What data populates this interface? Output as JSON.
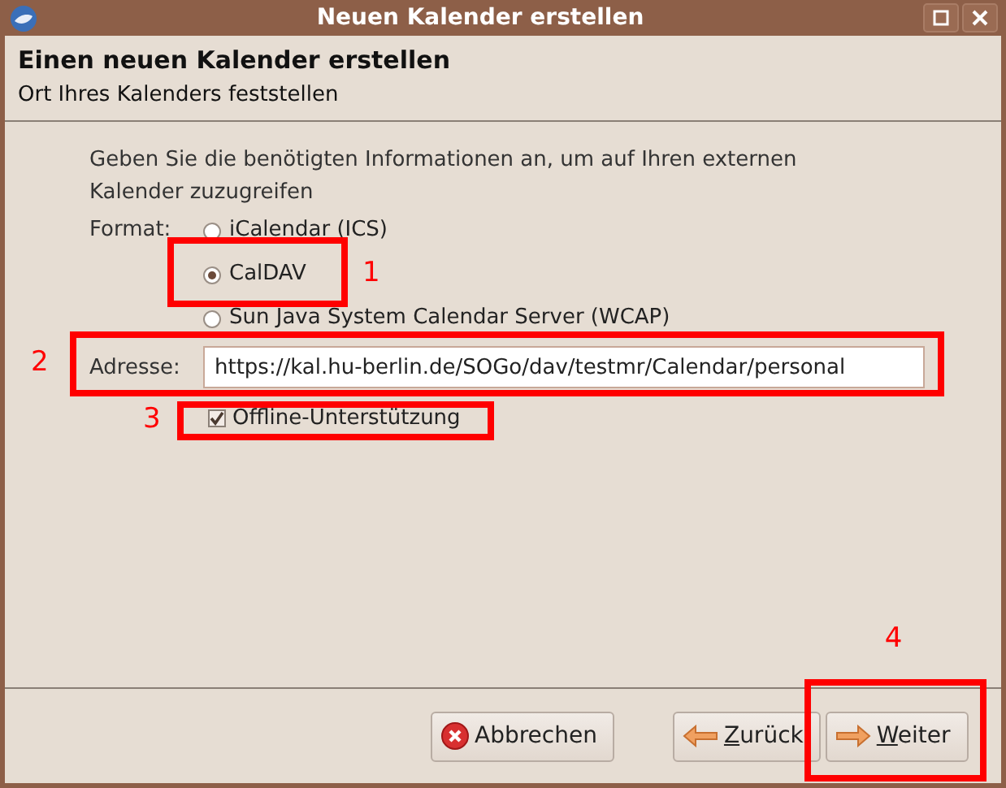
{
  "window": {
    "title": "Neuen Kalender erstellen"
  },
  "header": {
    "title": "Einen neuen Kalender erstellen",
    "subtitle": "Ort Ihres Kalenders feststellen"
  },
  "intro": "Geben Sie die benötigten Informationen an, um auf Ihren externen Kalender zuzugreifen",
  "format": {
    "label": "Format:",
    "options": [
      {
        "label": "iCalendar (ICS)",
        "selected": false
      },
      {
        "label": "CalDAV",
        "selected": true,
        "annotation": "1"
      },
      {
        "label": "Sun Java System Calendar Server (WCAP)",
        "selected": false
      }
    ]
  },
  "address": {
    "label": "Adresse:",
    "value": "https://kal.hu-berlin.de/SOGo/dav/testmr/Calendar/personal",
    "annotation": "2"
  },
  "offline": {
    "label": "Offline-Unterstützung",
    "checked": true,
    "annotation": "3"
  },
  "buttons": [
    {
      "kind": "cancel",
      "label": "Abbrechen",
      "underline_first": false
    },
    {
      "kind": "back",
      "label": "Zurück",
      "underline_first": true
    },
    {
      "kind": "next",
      "label": "Weiter",
      "underline_first": true,
      "annotation": "4"
    }
  ]
}
